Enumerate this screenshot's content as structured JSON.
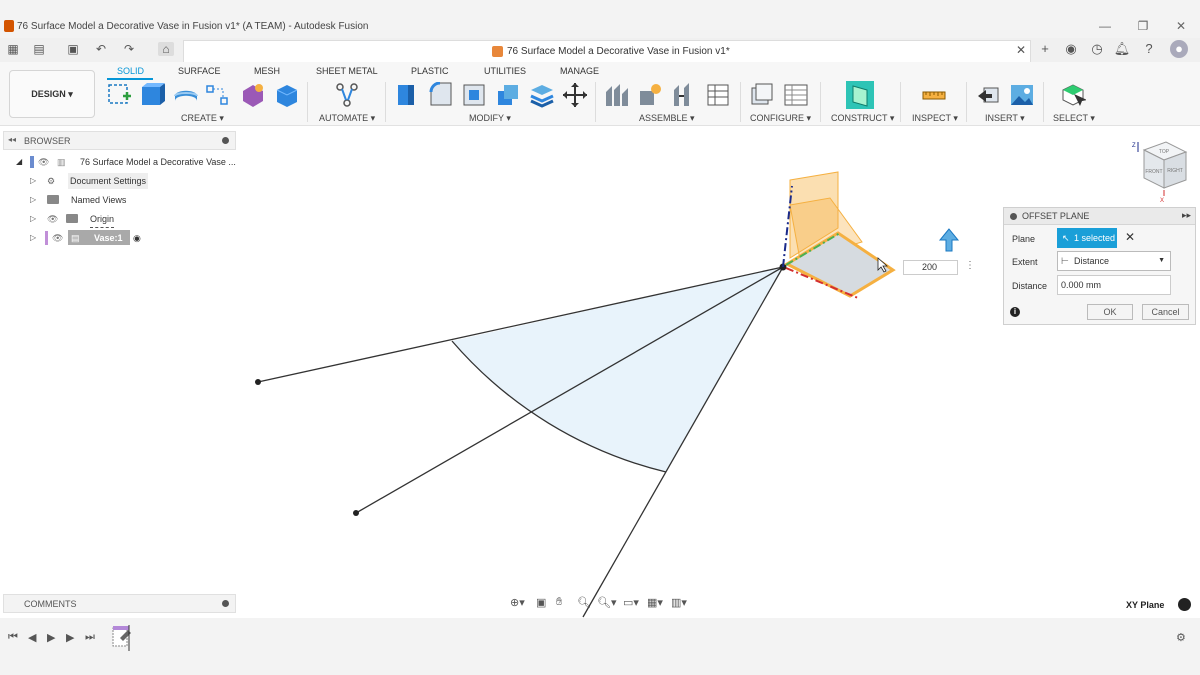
{
  "window": {
    "title": "76 Surface Model a Decorative Vase in Fusion v1* (A TEAM) - Autodesk Fusion",
    "minimize": "—",
    "restore": "❐",
    "close": "✕"
  },
  "doc_tab": {
    "title": "76 Surface Model a Decorative Vase in Fusion v1*",
    "close": "✕"
  },
  "workspace": {
    "label": "DESIGN ▾"
  },
  "ribbon_tabs": [
    "SOLID",
    "SURFACE",
    "MESH",
    "SHEET METAL",
    "PLASTIC",
    "UTILITIES",
    "MANAGE"
  ],
  "groups": {
    "create": "CREATE ▾",
    "automate": "AUTOMATE ▾",
    "modify": "MODIFY ▾",
    "assemble": "ASSEMBLE ▾",
    "configure": "CONFIGURE ▾",
    "construct": "CONSTRUCT ▾",
    "inspect": "INSPECT ▾",
    "insert": "INSERT ▾",
    "select": "SELECT ▾"
  },
  "browser": {
    "header": "BROWSER",
    "root": "76 Surface Model a Decorative Vase ...",
    "items": [
      "Document Settings",
      "Named Views",
      "Origin",
      "Vase:1"
    ]
  },
  "comments": {
    "header": "COMMENTS"
  },
  "offset_plane": {
    "title": "OFFSET PLANE",
    "plane_label": "Plane",
    "plane_value": "1 selected",
    "extent_label": "Extent",
    "extent_value": "Distance",
    "distance_label": "Distance",
    "distance_value": "0.000 mm",
    "ok": "OK",
    "cancel": "Cancel"
  },
  "float_input": {
    "value": "200"
  },
  "status": {
    "plane": "XY Plane"
  },
  "viewcube": {
    "top": "TOP",
    "front": "FRONT",
    "right": "RIGHT"
  },
  "colors": {
    "accent": "#0696d7",
    "selected": "#1a9fd8",
    "plane_orange": "#f5b041",
    "sector_fill": "#e8f3fb"
  }
}
